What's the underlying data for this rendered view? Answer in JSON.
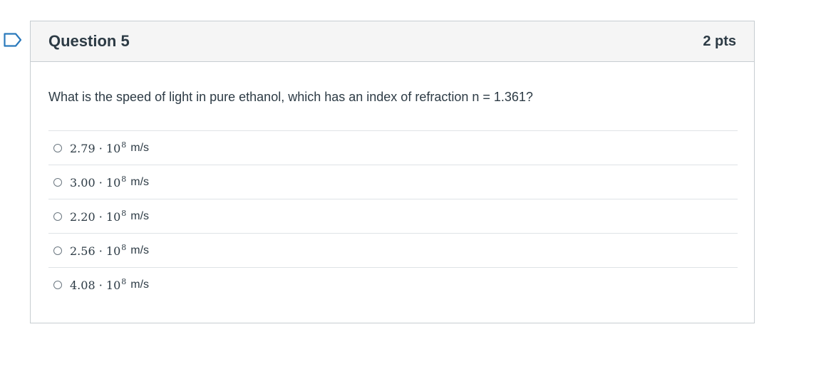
{
  "question": {
    "title": "Question 5",
    "points": "2 pts",
    "text": "What is the speed of light in pure ethanol, which has an index of refraction n = 1.361?",
    "answers": [
      {
        "mantissa": "2.79",
        "base": "10",
        "exponent": "8",
        "unit": "m/s"
      },
      {
        "mantissa": "3.00",
        "base": "10",
        "exponent": "8",
        "unit": "m/s"
      },
      {
        "mantissa": "2.20",
        "base": "10",
        "exponent": "8",
        "unit": "m/s"
      },
      {
        "mantissa": "2.56",
        "base": "10",
        "exponent": "8",
        "unit": "m/s"
      },
      {
        "mantissa": "4.08",
        "base": "10",
        "exponent": "8",
        "unit": "m/s"
      }
    ],
    "multiply_symbol": "·"
  },
  "colors": {
    "flag": "#2b7abc",
    "header_bg": "#f5f5f5",
    "border": "#c7cdd1",
    "text": "#2d3b45"
  },
  "icons": {
    "flag": "bookmark-flag-icon",
    "radio": "radio-unchecked-icon"
  }
}
